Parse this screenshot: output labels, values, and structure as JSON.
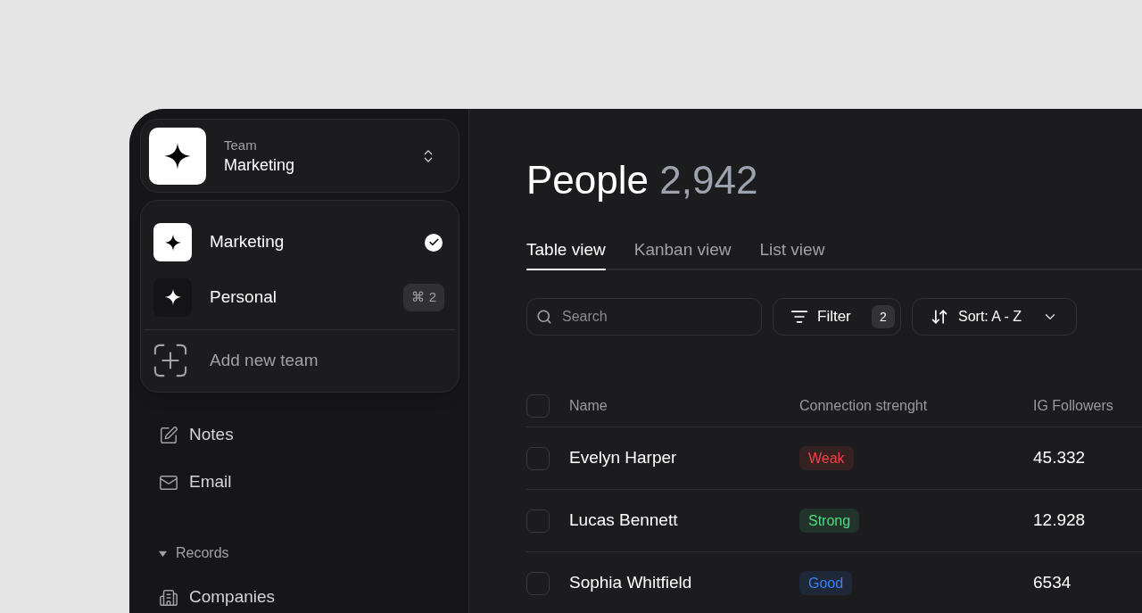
{
  "team_switcher": {
    "label": "Team",
    "team": "Marketing",
    "expanded": true
  },
  "team_menu": {
    "teams": [
      {
        "name": "Marketing",
        "selected": true
      },
      {
        "name": "Personal",
        "selected": false,
        "shortcut": "⌘ 2"
      }
    ],
    "add_label": "Add new team"
  },
  "sidebar": {
    "items": [
      {
        "kind": "item",
        "label": "Notes"
      },
      {
        "kind": "item",
        "label": "Email"
      },
      {
        "kind": "section",
        "label": "Records",
        "expanded": true
      },
      {
        "kind": "item",
        "label": "Companies"
      }
    ]
  },
  "page": {
    "title": "People",
    "count": "2,942"
  },
  "tabs": [
    {
      "label": "Table view",
      "selected": true
    },
    {
      "label": "Kanban view",
      "selected": false
    },
    {
      "label": "List view",
      "selected": false
    }
  ],
  "toolbar": {
    "search": {
      "placeholder": "Search"
    },
    "filter": {
      "label": "Filter",
      "count": "2"
    },
    "sort": {
      "label": "Sort: A - Z"
    }
  },
  "table": {
    "header_checked": false,
    "columns": [
      "Name",
      "Connection strenght",
      "IG Followers"
    ],
    "rows": [
      {
        "checked": false,
        "name": "Evelyn Harper",
        "strength": "Weak",
        "color": "#ef4444",
        "followers": "45.332"
      },
      {
        "checked": false,
        "name": "Lucas Bennett",
        "strength": "Strong",
        "color": "#4ade80",
        "followers": "12.928"
      },
      {
        "checked": false,
        "name": "Sophia Whitfield",
        "strength": "Good",
        "color": "#3b82f6",
        "followers": "6534"
      }
    ]
  }
}
